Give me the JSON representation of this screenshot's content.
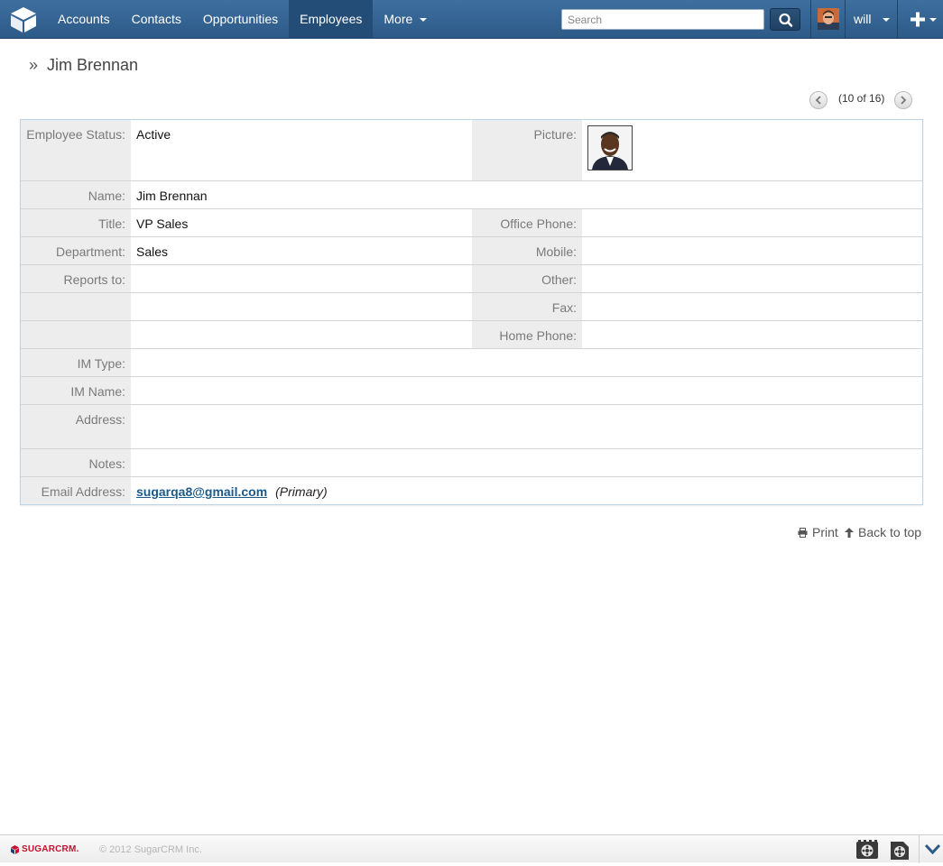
{
  "nav": {
    "tabs": [
      {
        "label": "Accounts"
      },
      {
        "label": "Contacts"
      },
      {
        "label": "Opportunities"
      },
      {
        "label": "Employees"
      },
      {
        "label": "More"
      }
    ],
    "search_placeholder": "Search",
    "user_name": "will",
    "colors": {
      "bar": "#2d5a87",
      "active_tab": "#234d77"
    },
    "icons": [
      "cube-logo-icon",
      "search-icon",
      "user-avatar",
      "plus-icon",
      "caret-down-icon"
    ]
  },
  "header": {
    "breadcrumb_arrow": "»",
    "title": "Jim Brennan",
    "pager": "(10 of 16)"
  },
  "detail": {
    "employee_status": {
      "label": "Employee Status:",
      "value": "Active"
    },
    "picture": {
      "label": "Picture:"
    },
    "name": {
      "label": "Name:",
      "value": "Jim Brennan"
    },
    "title": {
      "label": "Title:",
      "value": "VP Sales"
    },
    "office_phone": {
      "label": "Office Phone:",
      "value": ""
    },
    "department": {
      "label": "Department:",
      "value": "Sales"
    },
    "mobile": {
      "label": "Mobile:",
      "value": ""
    },
    "reports_to": {
      "label": "Reports to:",
      "value": ""
    },
    "other": {
      "label": "Other:",
      "value": ""
    },
    "fax": {
      "label": "Fax:",
      "value": ""
    },
    "home_phone": {
      "label": "Home Phone:",
      "value": ""
    },
    "im_type": {
      "label": "IM Type:",
      "value": ""
    },
    "im_name": {
      "label": "IM Name:",
      "value": ""
    },
    "address": {
      "label": "Address:",
      "value": ""
    },
    "notes": {
      "label": "Notes:",
      "value": ""
    },
    "email": {
      "label": "Email Address:",
      "value": "sugarqa8@gmail.com",
      "tag": "(Primary)"
    }
  },
  "actions": {
    "print": "Print",
    "back_to_top": "Back to top"
  },
  "footer": {
    "brand": "SUGARCRM.",
    "copyright": "© 2012 SugarCRM Inc."
  }
}
